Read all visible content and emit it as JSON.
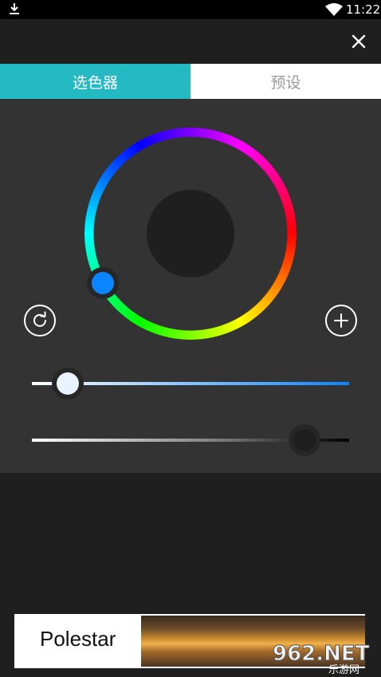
{
  "status_bar": {
    "time": "11:22",
    "icons": [
      "download-icon",
      "wifi-icon",
      "battery-icon"
    ]
  },
  "toolbar": {
    "close_icon": "close-icon"
  },
  "tabs": [
    {
      "label": "选色器",
      "active": true
    },
    {
      "label": "预设",
      "active": false
    }
  ],
  "color_picker": {
    "selected_color": "#0a84ff",
    "preview_color": "#1f1f1f",
    "saturation_level": 0.07,
    "brightness_level": 0.9,
    "buttons": {
      "reset_icon": "refresh-icon",
      "add_icon": "plus-icon"
    }
  },
  "colors": {
    "accent": "#24b9c3",
    "panel": "#333333",
    "background": "#1f1f1f"
  },
  "ad": {
    "brand": "Polestar"
  },
  "watermark": {
    "site": "962.NET",
    "label": "乐游网"
  }
}
